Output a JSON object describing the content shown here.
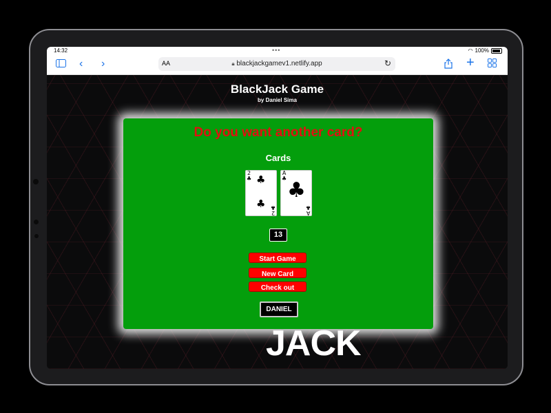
{
  "browser": {
    "time": "14:32",
    "battery": "100%",
    "url": "blackjackgamev1.netlify.app",
    "reader_label": "AA"
  },
  "page": {
    "title": "BlackJack Game",
    "subtitle": "by Daniel Sima",
    "background_word": "JACK"
  },
  "game": {
    "message": "Do you want another card?",
    "cards_label": "Cards",
    "cards": [
      {
        "rank": "2",
        "suit": "clubs",
        "symbol": "♣"
      },
      {
        "rank": "A",
        "suit": "clubs",
        "symbol": "♣"
      }
    ],
    "sum": "13",
    "buttons": {
      "start": "Start Game",
      "new_card": "New Card",
      "check_out": "Check out"
    },
    "player": "DANIEL"
  },
  "colors": {
    "panel_green": "#049e0c",
    "message_red": "#e01010",
    "button_red": "#ff0000",
    "link_blue": "#1a73e8"
  }
}
